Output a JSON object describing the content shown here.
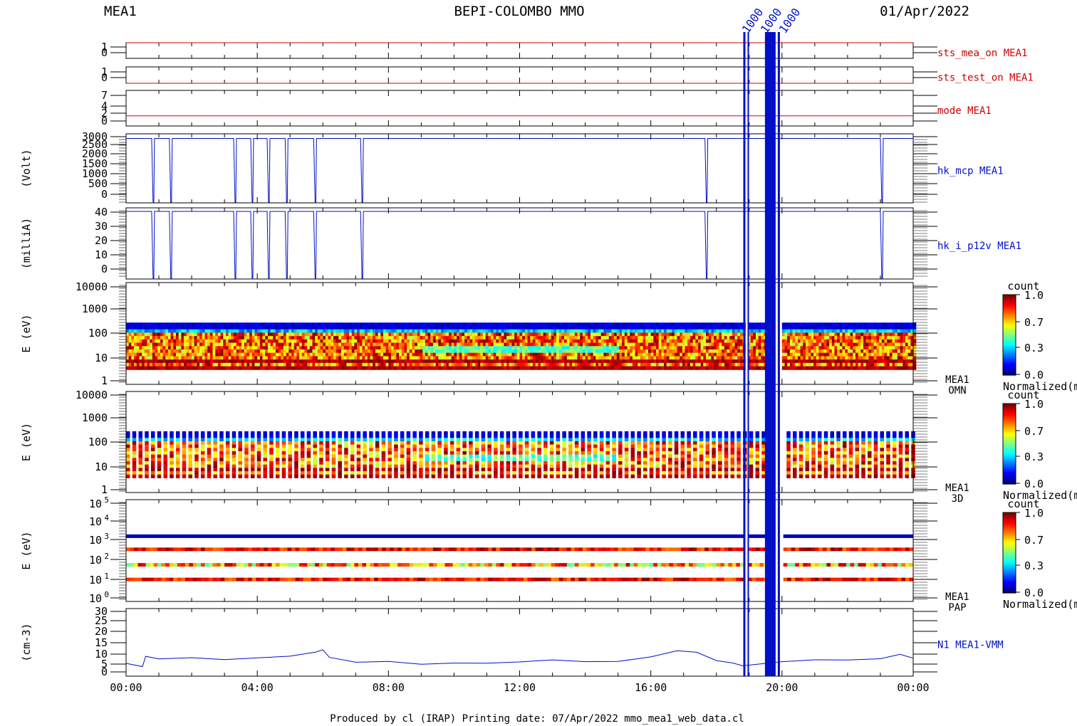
{
  "header": {
    "left": "MEA1",
    "center": "BEPI-COLOMBO MMO",
    "right": "01/Apr/2022"
  },
  "footer": "Produced by cl (IRAP)   Printing date: 07/Apr/2022   mmo_mea1_web_data.cl",
  "colors": {
    "red": "#d00000",
    "blue": "#0010c8",
    "black": "#000000"
  },
  "chart_data": {
    "type": "line",
    "x_ticks": [
      "00:00",
      "04:00",
      "08:00",
      "12:00",
      "16:00",
      "20:00",
      "00:00"
    ],
    "x_range_hours": [
      0,
      24
    ],
    "gap_hours": [
      [
        18.82,
        18.9
      ],
      [
        19.48,
        19.98
      ]
    ],
    "gap_label_text": [
      "1000",
      "1000",
      "1000"
    ],
    "panels": [
      {
        "name": "sts_mea_on",
        "label": "sts_mea_on MEA1",
        "color": "red",
        "ylabel": "",
        "ticks": [
          "1",
          "0"
        ],
        "ylim": [
          0,
          1
        ],
        "series": [
          {
            "x": [
              0,
              24
            ],
            "y": [
              1,
              1
            ]
          }
        ]
      },
      {
        "name": "sts_test_on",
        "label": "sts_test_on MEA1",
        "color": "red",
        "ylabel": "",
        "ticks": [
          "1",
          "0"
        ],
        "ylim": [
          0,
          1
        ],
        "series": [
          {
            "x": [
              0,
              24
            ],
            "y": [
              0,
              0
            ]
          }
        ]
      },
      {
        "name": "mode",
        "label": "mode MEA1",
        "color": "red",
        "ylabel": "",
        "ticks": [
          "7",
          "4",
          "2",
          "0"
        ],
        "ylim": [
          0,
          7
        ],
        "series": [
          {
            "x": [
              0,
              24
            ],
            "y": [
              2,
              2
            ]
          }
        ]
      },
      {
        "name": "hk_mcp",
        "label": "hk_mcp MEA1",
        "color": "blue",
        "ylabel": "(Volt)",
        "ticks": [
          "3000",
          "2500",
          "2000",
          "1500",
          "1000",
          "500",
          "0"
        ],
        "ylim": [
          0,
          3000
        ],
        "high": 2800,
        "low": 0,
        "drops_hours": [
          0.78,
          1.32,
          3.28,
          3.8,
          4.3,
          4.85,
          5.72,
          7.15,
          17.65,
          23.0
        ]
      },
      {
        "name": "hk_i_p12v",
        "label": "hk_i_p12v MEA1",
        "color": "blue",
        "ylabel": "(milliA)",
        "ticks": [
          "40",
          "30",
          "20",
          "10",
          "0"
        ],
        "ylim": [
          0,
          40
        ],
        "high": 38,
        "low": 0,
        "drops_hours": [
          0.78,
          1.32,
          3.28,
          3.8,
          4.3,
          4.85,
          5.72,
          7.15,
          17.65,
          23.0
        ]
      },
      {
        "name": "omni",
        "label": "MEA1",
        "sublabel": "OMN",
        "ylabel": "E (eV)",
        "ticks": [
          "10000",
          "1000",
          "100",
          "10",
          "1"
        ],
        "energy_range_ev": [
          3,
          300
        ]
      },
      {
        "name": "3d",
        "label": "MEA1",
        "sublabel": "3D",
        "ylabel": "E (eV)",
        "ticks": [
          "10000",
          "1000",
          "100",
          "10",
          "1"
        ],
        "energy_range_ev": [
          3,
          300
        ]
      },
      {
        "name": "pap",
        "label": "MEA1",
        "sublabel": "PAP",
        "ylabel": "E (eV)",
        "tick_base": [
          "10",
          "10",
          "10",
          "10",
          "10",
          "10"
        ],
        "tick_exp": [
          "5",
          "4",
          "3",
          "2",
          "1",
          "0"
        ],
        "bands_ev": [
          2000,
          400,
          60,
          10
        ]
      },
      {
        "name": "density",
        "label": "N1 MEA1-VMM",
        "color": "blue",
        "ylabel": "(cm-3)",
        "ticks": [
          "30",
          "25",
          "20",
          "15",
          "10",
          "5",
          "0"
        ],
        "ylim": [
          0,
          30
        ],
        "series": [
          {
            "x": [
              0,
              0.5,
              0.6,
              1,
              2,
              3,
              4,
              5,
              5.8,
              6.0,
              6.2,
              7,
              8,
              9,
              10,
              11,
              12,
              13,
              14,
              15,
              16,
              16.8,
              17.4,
              18,
              18.5,
              18.8,
              20,
              21,
              22,
              23,
              23.6,
              24
            ],
            "y": [
              5,
              5,
              9,
              8,
              8,
              8,
              8.5,
              9,
              10,
              12,
              8,
              6,
              6,
              6,
              6,
              6,
              6,
              7,
              7,
              7,
              8,
              11,
              10,
              7,
              6,
              5,
              6,
              7,
              7,
              8,
              9,
              8
            ]
          }
        ]
      }
    ],
    "colorbars": [
      {
        "title": "count",
        "ticks": [
          "1.0",
          "0.7",
          "0.3",
          "0.0"
        ],
        "caption": "Normalized(m"
      },
      {
        "title": "count",
        "ticks": [
          "1.0",
          "0.7",
          "0.3",
          "0.0"
        ],
        "caption": "Normalized(m"
      },
      {
        "title": "count",
        "ticks": [
          "1.0",
          "0.7",
          "0.3",
          "0.0"
        ],
        "caption": "Normalized(m"
      }
    ]
  }
}
